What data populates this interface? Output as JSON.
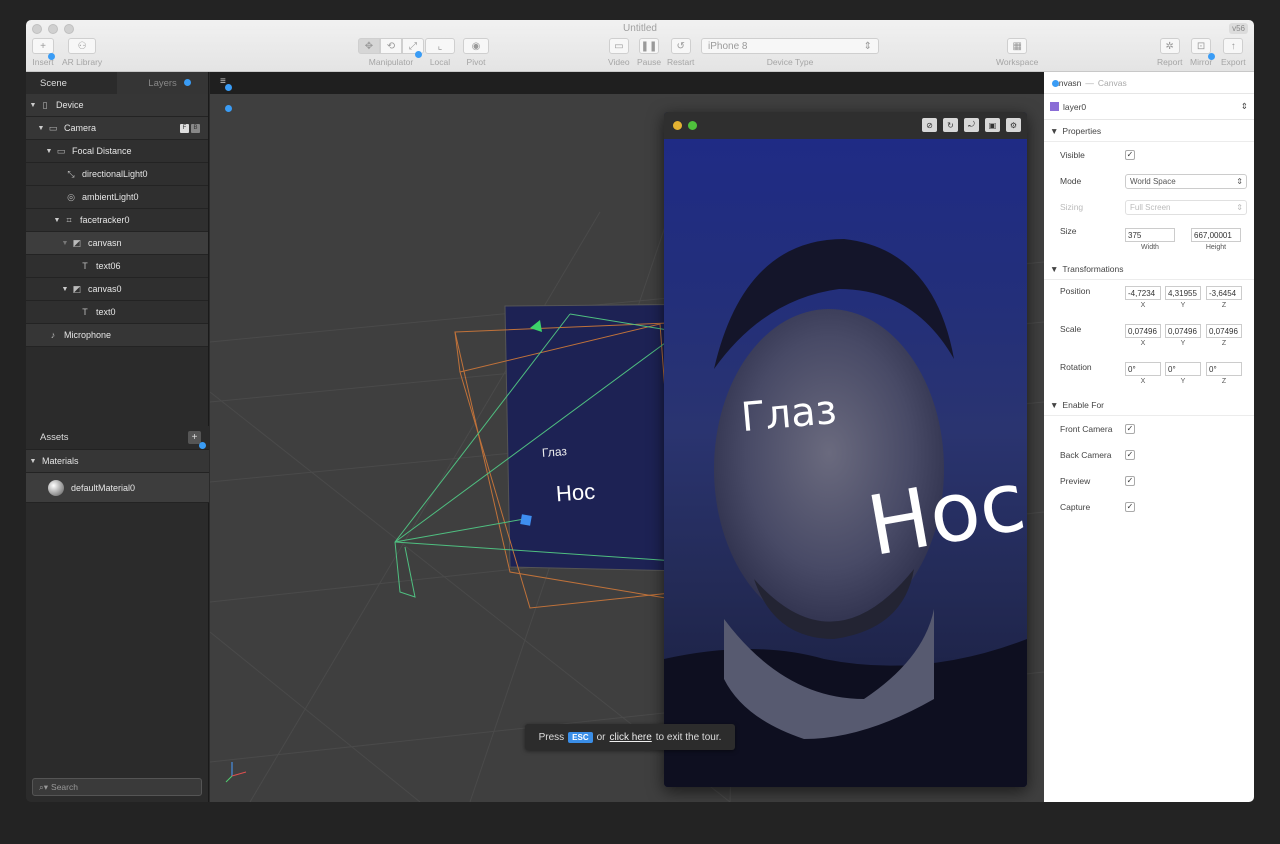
{
  "window": {
    "title": "Untitled",
    "version": "v56"
  },
  "toolbar": {
    "insert": "Insert",
    "ar_library": "AR Library",
    "manipulator": "Manipulator",
    "local": "Local",
    "pivot": "Pivot",
    "video": "Video",
    "pause": "Pause",
    "restart": "Restart",
    "device_value": "iPhone 8",
    "device_type": "Device Type",
    "workspace": "Workspace",
    "report": "Report",
    "mirror": "Mirror",
    "export": "Export"
  },
  "left": {
    "tabs": {
      "scene": "Scene",
      "layers": "Layers"
    },
    "scene_tree": [
      {
        "label": "Device",
        "icon": "phone-icon"
      },
      {
        "label": "Camera",
        "icon": "camera-icon",
        "badges": [
          "F",
          "B"
        ]
      },
      {
        "label": "Focal Distance",
        "icon": "focal-icon"
      },
      {
        "label": "directionalLight0",
        "icon": "light-icon"
      },
      {
        "label": "ambientLight0",
        "icon": "ambient-icon"
      },
      {
        "label": "facetracker0",
        "icon": "facetracker-icon"
      },
      {
        "label": "canvasn",
        "icon": "canvas-icon"
      },
      {
        "label": "text06",
        "icon": "text-icon"
      },
      {
        "label": "canvas0",
        "icon": "canvas-icon"
      },
      {
        "label": "text0",
        "icon": "text-icon"
      },
      {
        "label": "Microphone",
        "icon": "microphone-icon"
      }
    ],
    "assets_title": "Assets",
    "materials_label": "Materials",
    "material_item": "defaultMaterial0",
    "search_placeholder": "Search"
  },
  "viewport": {
    "label_eye": "Глаз",
    "label_nose": "Нос"
  },
  "simulator": {
    "label_eye": "Глаз",
    "label_nose": "Нос"
  },
  "tour": {
    "press": "Press",
    "esc": "ESC",
    "or": "or",
    "click_here": "click here",
    "tail": "to exit the tour."
  },
  "inspector": {
    "object_name": "anvasn",
    "object_type": "Canvas",
    "layer": "layer0",
    "sections": {
      "properties": "Properties",
      "transformations": "Transformations",
      "enable_for": "Enable For"
    },
    "properties": {
      "visible_label": "Visible",
      "mode_label": "Mode",
      "mode_value": "World Space",
      "sizing_label": "Sizing",
      "sizing_value": "Full Screen",
      "size_label": "Size",
      "width_value": "375",
      "height_value": "667,00001",
      "width_caption": "Width",
      "height_caption": "Height"
    },
    "transform": {
      "position_label": "Position",
      "position": [
        "-4,7234",
        "4,31955",
        "-3,6454"
      ],
      "scale_label": "Scale",
      "scale": [
        "0,07496",
        "0,07496",
        "0,07496"
      ],
      "rotation_label": "Rotation",
      "rotation": [
        "0°",
        "0°",
        "0°"
      ],
      "axes": [
        "X",
        "Y",
        "Z"
      ]
    },
    "enable_for": [
      "Front Camera",
      "Back Camera",
      "Preview",
      "Capture"
    ]
  },
  "colors": {
    "accent": "#3a9cf5",
    "layer_swatch": "#8a6dd6"
  }
}
